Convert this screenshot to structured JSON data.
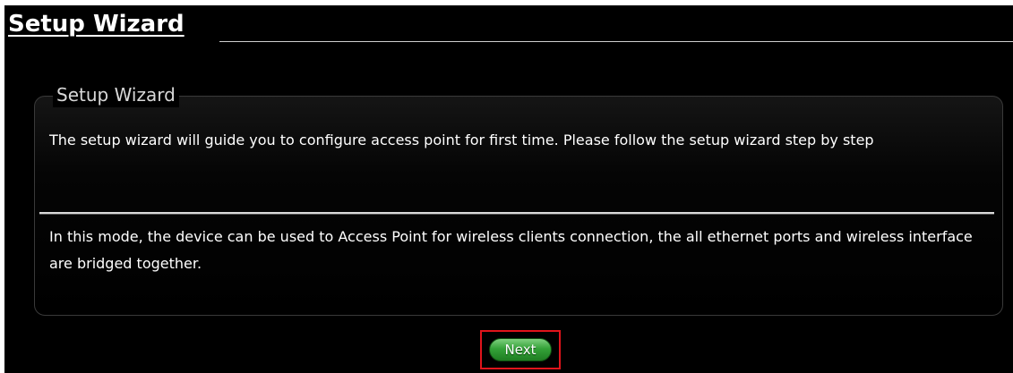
{
  "page": {
    "title": "Setup Wizard"
  },
  "panel": {
    "legend": "Setup Wizard",
    "intro": "The setup wizard will guide you to configure access point for first time. Please follow the setup wizard step by step",
    "mode_description": "In this mode, the device can be used to Access Point for wireless clients connection, the all ethernet ports and wireless interface are bridged together."
  },
  "actions": {
    "next_label": "Next"
  },
  "colors": {
    "background": "#000000",
    "text": "#ffffff",
    "button": "#2f9a33",
    "highlight_frame": "#e0141b"
  }
}
